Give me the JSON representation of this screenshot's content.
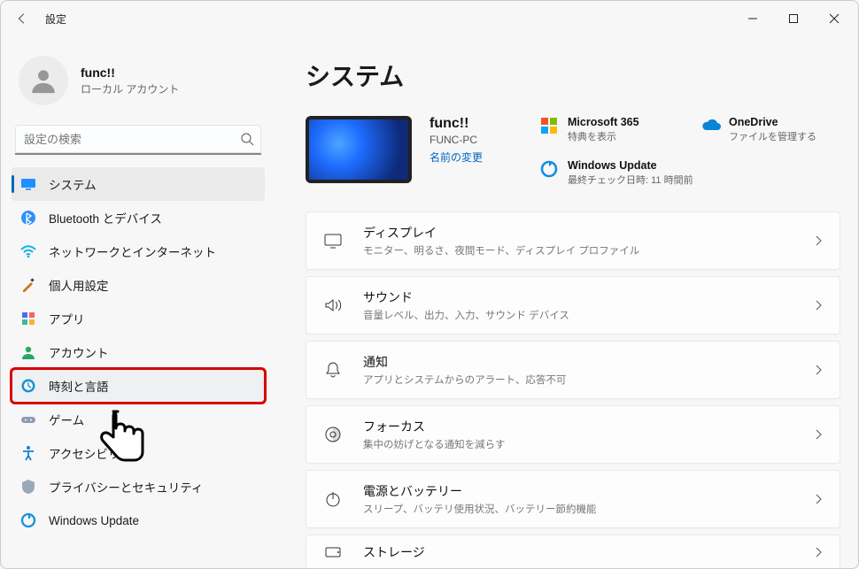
{
  "window": {
    "title": "設定"
  },
  "user": {
    "name": "func!!",
    "subtitle": "ローカル アカウント"
  },
  "search": {
    "placeholder": "設定の検索"
  },
  "sidebar": {
    "items": [
      {
        "label": "システム"
      },
      {
        "label": "Bluetooth とデバイス"
      },
      {
        "label": "ネットワークとインターネット"
      },
      {
        "label": "個人用設定"
      },
      {
        "label": "アプリ"
      },
      {
        "label": "アカウント"
      },
      {
        "label": "時刻と言語"
      },
      {
        "label": "ゲーム"
      },
      {
        "label": "アクセシビリティ"
      },
      {
        "label": "プライバシーとセキュリティ"
      },
      {
        "label": "Windows Update"
      }
    ]
  },
  "page": {
    "title": "システム"
  },
  "device": {
    "name": "func!!",
    "id": "FUNC-PC",
    "rename": "名前の変更"
  },
  "tiles": {
    "m365": {
      "title": "Microsoft 365",
      "sub": "特典を表示"
    },
    "onedrive": {
      "title": "OneDrive",
      "sub": "ファイルを管理する"
    },
    "update": {
      "title": "Windows Update",
      "sub": "最終チェック日時: 11 時間前"
    }
  },
  "cards": [
    {
      "title": "ディスプレイ",
      "sub": "モニター、明るさ、夜間モード、ディスプレイ プロファイル"
    },
    {
      "title": "サウンド",
      "sub": "音量レベル、出力、入力、サウンド デバイス"
    },
    {
      "title": "通知",
      "sub": "アプリとシステムからのアラート、応答不可"
    },
    {
      "title": "フォーカス",
      "sub": "集中の妨げとなる通知を減らす"
    },
    {
      "title": "電源とバッテリー",
      "sub": "スリープ、バッテリ使用状況、バッテリー節約機能"
    },
    {
      "title": "ストレージ",
      "sub": ""
    }
  ]
}
